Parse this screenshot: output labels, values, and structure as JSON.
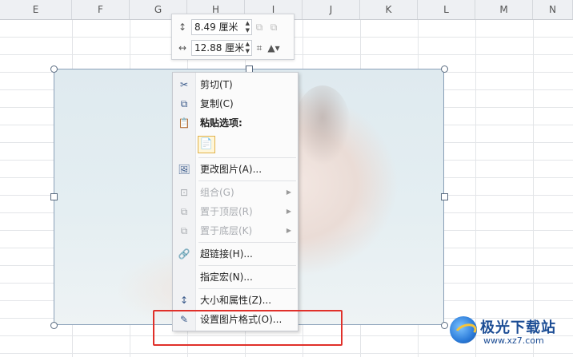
{
  "columns": [
    "E",
    "F",
    "G",
    "H",
    "I",
    "J",
    "K",
    "L",
    "M",
    "N"
  ],
  "size_toolbar": {
    "height_value": "8.49 厘米",
    "width_value": "12.88 厘米",
    "height_icon": "height-icon",
    "width_icon": "width-icon"
  },
  "context_menu": {
    "cut": "剪切(T)",
    "copy": "复制(C)",
    "paste_options": "粘贴选项:",
    "change_picture": "更改图片(A)...",
    "group": "组合(G)",
    "bring_to_front": "置于顶层(R)",
    "send_to_back": "置于底层(K)",
    "hyperlink": "超链接(H)...",
    "assign_macro": "指定宏(N)...",
    "size_properties": "大小和属性(Z)...",
    "format_picture": "设置图片格式(O)..."
  },
  "watermark": {
    "title": "极光下载站",
    "url": "www.xz7.com"
  },
  "colors": {
    "highlight": "#e0302a",
    "header_bg": "#eef0f3"
  }
}
